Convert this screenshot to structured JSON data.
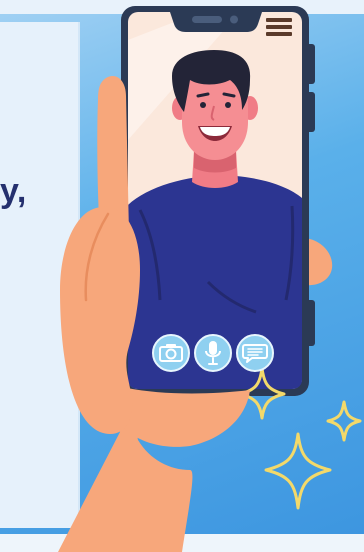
{
  "card": {
    "text_fragment": "y,"
  },
  "colors": {
    "background_blue": "#5ab0ea",
    "card_text": "#24306e",
    "hand_skin": "#f7a77b",
    "phone_body": "#2b3a55",
    "shirt": "#2c3591",
    "sparkle": "#f3d96a",
    "call_button": "#8fd0f0"
  },
  "icons": {
    "camera": "camera-icon",
    "microphone": "microphone-icon",
    "chat": "chat-bubble-icon",
    "menu": "hamburger-menu-icon",
    "sparkles": "sparkle-icon"
  }
}
